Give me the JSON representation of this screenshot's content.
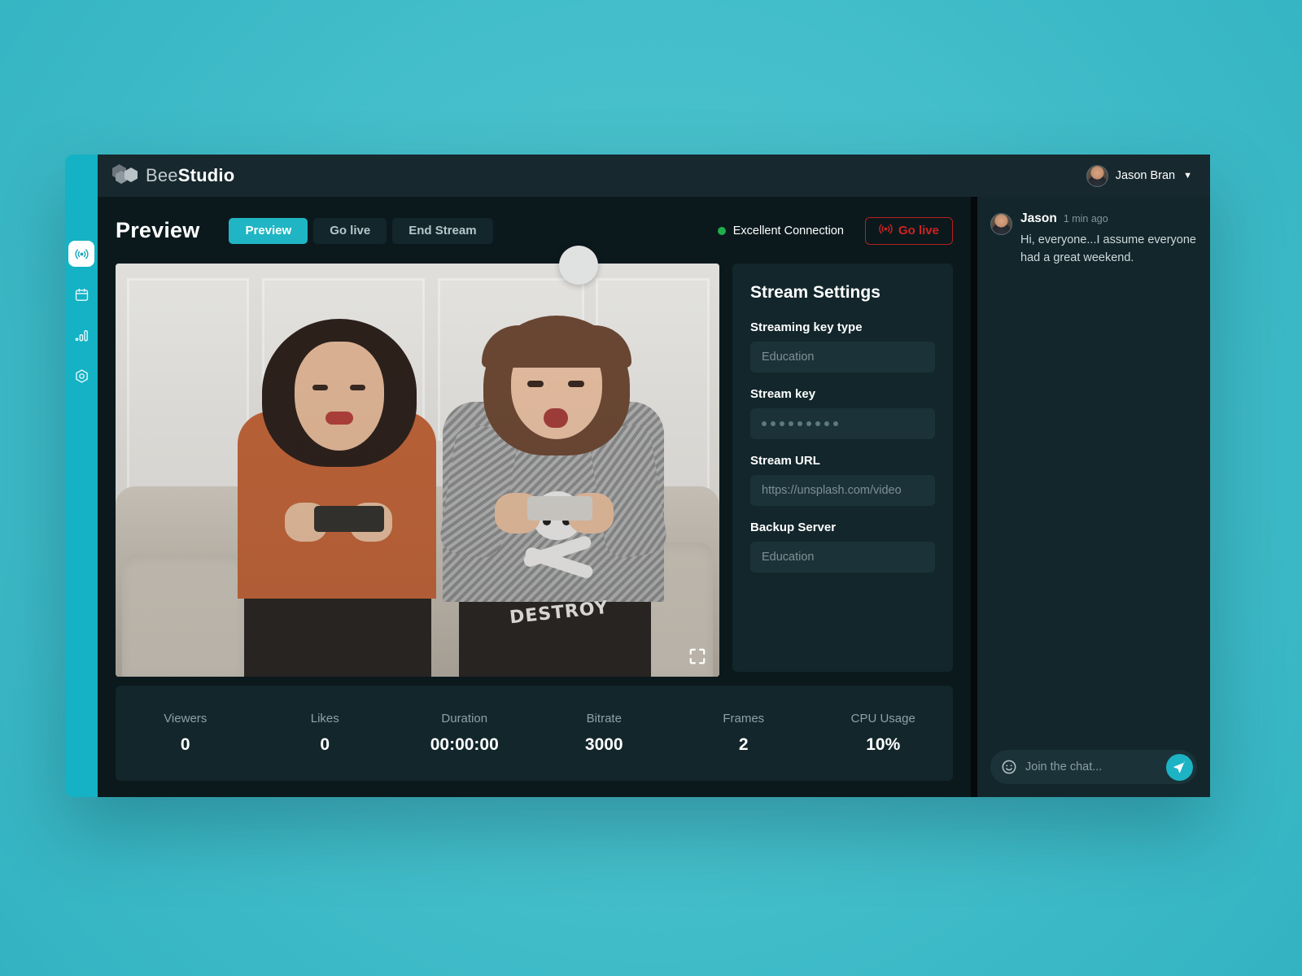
{
  "brand": {
    "thin": "Bee",
    "bold": "Studio",
    "mark_icon": "hexagon-bee-logo"
  },
  "topbar": {
    "user_name": "Jason Bran",
    "avatar_icon": "user-avatar",
    "caret_icon": "chevron-down-icon"
  },
  "sidebar": {
    "items": [
      {
        "icon": "broadcast-icon",
        "name": "sidebar-item-live",
        "active": true
      },
      {
        "icon": "calendar-icon",
        "name": "sidebar-item-schedule",
        "active": false
      },
      {
        "icon": "bar-chart-icon",
        "name": "sidebar-item-analytics",
        "active": false
      },
      {
        "icon": "settings-hexagon-icon",
        "name": "sidebar-item-settings",
        "active": false
      }
    ]
  },
  "page": {
    "title": "Preview",
    "tabs": [
      {
        "label": "Preview",
        "active": true
      },
      {
        "label": "Go live",
        "active": false
      },
      {
        "label": "End Stream",
        "active": false
      }
    ],
    "connection": {
      "label": "Excellent Connection",
      "status_color": "#1fae4b"
    },
    "golive_button": {
      "label": "Go live",
      "icon": "broadcast-icon",
      "color": "#cf2222"
    }
  },
  "video": {
    "fullscreen_icon": "fullscreen-expand-icon",
    "handle_icon": "drag-handle-circle"
  },
  "settings": {
    "title": "Stream Settings",
    "fields": [
      {
        "label": "Streaming key type",
        "placeholder": "Education",
        "type": "text"
      },
      {
        "label": "Stream key",
        "placeholder": "",
        "type": "password",
        "masked_count": 9
      },
      {
        "label": "Stream URL",
        "placeholder": "https://unsplash.com/video",
        "type": "text"
      },
      {
        "label": "Backup Server",
        "placeholder": "Education",
        "type": "text"
      }
    ]
  },
  "stats": [
    {
      "label": "Viewers",
      "value": "0"
    },
    {
      "label": "Likes",
      "value": "0"
    },
    {
      "label": "Duration",
      "value": "00:00:00"
    },
    {
      "label": "Bitrate",
      "value": "3000"
    },
    {
      "label": "Frames",
      "value": "2"
    },
    {
      "label": "CPU Usage",
      "value": "10%"
    }
  ],
  "chat": {
    "message": {
      "name": "Jason",
      "time": "1 min ago",
      "text": "Hi, everyone...I assume everyone had a great weekend."
    },
    "input": {
      "placeholder": "Join the chat...",
      "emoji_icon": "smiley-icon",
      "send_icon": "send-paper-plane-icon"
    }
  },
  "colors": {
    "accent": "#20b5c4",
    "rail": "#14b2c4",
    "danger": "#cf2222",
    "online": "#1fae4b",
    "panel": "#12262b",
    "background": "#45bfcb"
  }
}
